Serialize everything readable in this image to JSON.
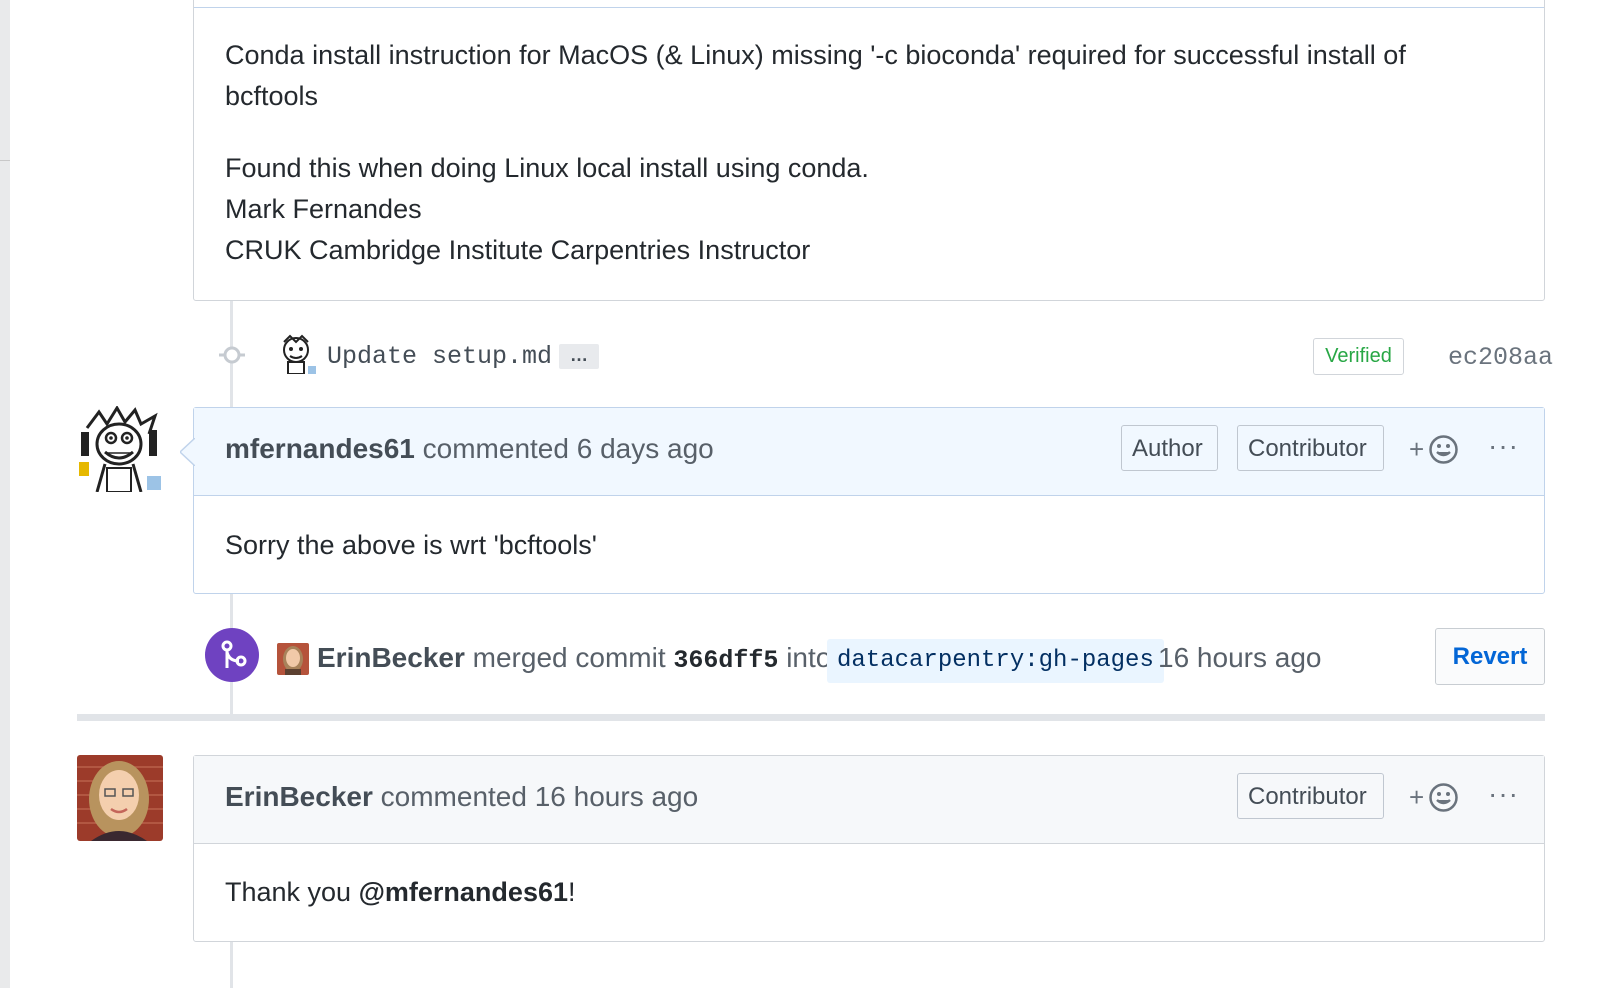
{
  "first_comment": {
    "body_line_1": "Conda install instruction for MacOS (& Linux) missing '-c bioconda' required for successful install of",
    "body_line_2": "bcftools",
    "body_line_3": "Found this when doing Linux local install using conda.",
    "body_line_4": "Mark Fernandes",
    "body_line_5": "CRUK Cambridge Institute Carpentries Instructor"
  },
  "commit": {
    "message": "Update setup.md",
    "ellipsis": "…",
    "verified_label": "Verified",
    "sha": "ec208aa",
    "colors": {
      "verified": "#28a745"
    }
  },
  "second_comment": {
    "author": "mfernandes61",
    "meta": "commented 6 days ago",
    "labels": [
      "Author",
      "Contributor"
    ],
    "reaction_plus": "+",
    "body": "Sorry the above is wrt 'bcftools'"
  },
  "merge_event": {
    "actor": "ErinBecker",
    "action": "merged commit",
    "commit_sha": "366dff5",
    "into_text": "into",
    "branch": "datacarpentry:gh-pages",
    "time": "16 hours ago",
    "revert_label": "Revert",
    "colors": {
      "merge_badge": "#6f42c1",
      "link": "#0366d6",
      "branch_bg": "#eaf5ff"
    }
  },
  "third_comment": {
    "author": "ErinBecker",
    "meta": "commented 16 hours ago",
    "labels": [
      "Contributor"
    ],
    "reaction_plus": "+",
    "body_prefix": "Thank you ",
    "mention": "@mfernandes61",
    "body_suffix": "!"
  },
  "icons": [
    "commit-dot-icon",
    "merge-icon",
    "smiley-icon",
    "kebab-icon"
  ]
}
